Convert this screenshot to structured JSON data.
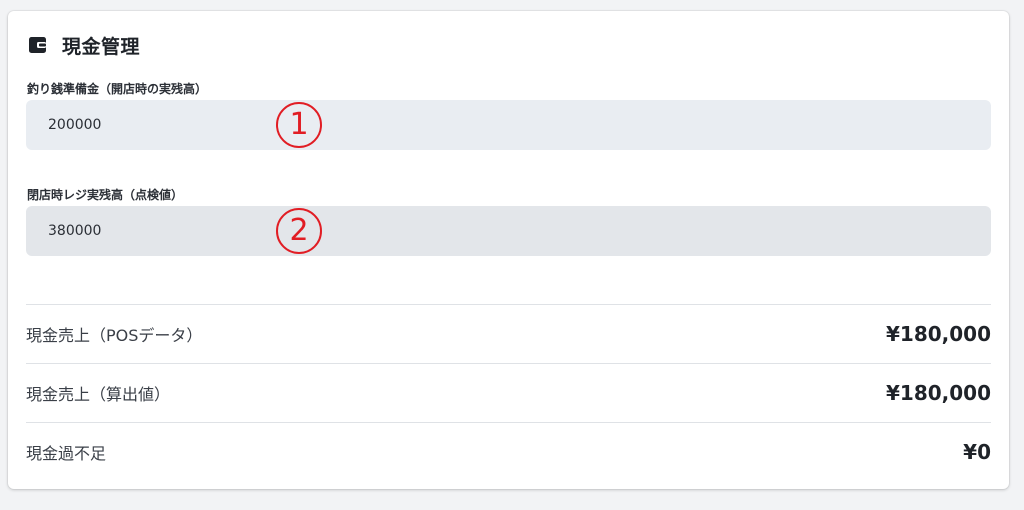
{
  "card": {
    "title": "現金管理",
    "icon": "wallet-icon"
  },
  "fields": [
    {
      "label": "釣り銭準備金（開店時の実残高）",
      "value": "200000",
      "annotation": "1"
    },
    {
      "label": "閉店時レジ実残高（点検値）",
      "value": "380000",
      "annotation": "2"
    }
  ],
  "summary": [
    {
      "label": "現金売上（POSデータ）",
      "value": "¥180,000"
    },
    {
      "label": "現金売上（算出値）",
      "value": "¥180,000"
    },
    {
      "label": "現金過不足",
      "value": "¥0"
    }
  ],
  "colors": {
    "annotation": "#e11d24",
    "input_bg": "#e9edf2",
    "divider": "#dfe2e6"
  }
}
